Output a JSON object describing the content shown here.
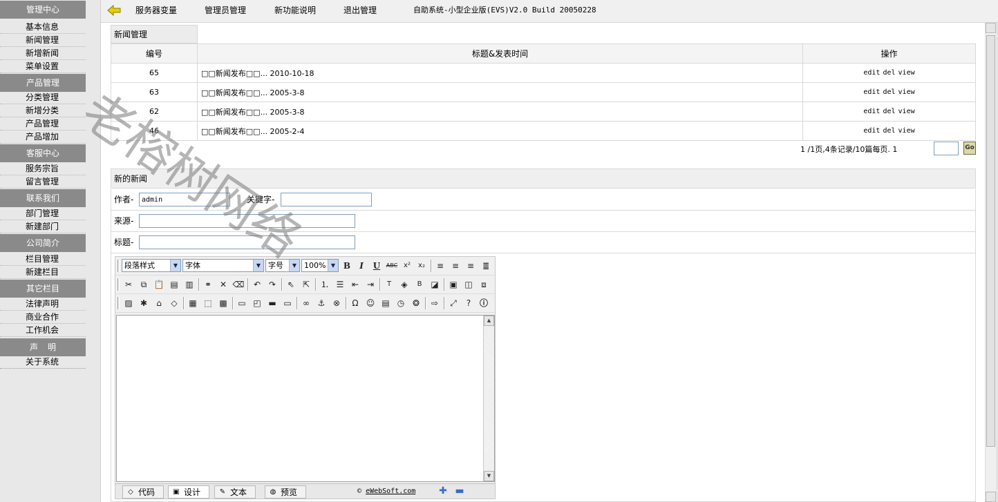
{
  "sidebar": {
    "sections": [
      {
        "title": "管理中心",
        "items": [
          "基本信息",
          "新闻管理",
          "新增新闻",
          "菜单设置"
        ]
      },
      {
        "title": "产品管理",
        "items": [
          "分类管理",
          "新增分类",
          "产品管理",
          "产品增加"
        ]
      },
      {
        "title": "客服中心",
        "items": [
          "服务宗旨",
          "留言管理"
        ]
      },
      {
        "title": "联系我们",
        "items": [
          "部门管理",
          "新建部门"
        ]
      },
      {
        "title": "公司简介",
        "items": [
          "栏目管理",
          "新建栏目"
        ]
      },
      {
        "title": "其它栏目",
        "items": [
          "法律声明",
          "商业合作",
          "工作机会"
        ]
      },
      {
        "title": "声明",
        "items": [
          "关于系统"
        ]
      }
    ]
  },
  "topbar": {
    "links": [
      "服务器变量",
      "管理员管理",
      "新功能说明",
      "退出管理"
    ],
    "system_info": "自助系统-小型企业版(EVS)V2.0 Build 20050228"
  },
  "news_list": {
    "tab_label": "新闻管理",
    "columns": [
      "编号",
      "标题&发表时间",
      "操作"
    ],
    "rows": [
      {
        "id": "65",
        "title": "□□新闻发布□□... 2010-10-18"
      },
      {
        "id": "63",
        "title": "□□新闻发布□□... 2005-3-8"
      },
      {
        "id": "62",
        "title": "□□新闻发布□□... 2005-3-8"
      },
      {
        "id": "46",
        "title": "□□新闻发布□□... 2005-2-4"
      }
    ],
    "ops": [
      "edit",
      "del",
      "view"
    ],
    "pager_text": "1 /1页,4条记录/10篇每页. 1",
    "go_label": "Go"
  },
  "new_news": {
    "heading": "新的新闻",
    "author_label": "作者-",
    "author_value": "admin",
    "keyword_label": "关键字-",
    "keyword_value": "",
    "source_label": "来源-",
    "source_value": "",
    "title_label": "标题-",
    "title_value": ""
  },
  "editor": {
    "paragraph_style": "段落样式",
    "font": "字体",
    "font_size": "字号",
    "zoom": "100%",
    "modes": [
      "代码",
      "设计",
      "文本",
      "预览"
    ],
    "active_mode": "设计",
    "copyright_prefix": "©",
    "copyright_site": "eWebSoft.com"
  },
  "watermark": "老榕树网络",
  "colors": {
    "sidebar_bg": "#e8e8e8",
    "section_head_bg": "#8a8a8a",
    "back_arrow": "#e6d000"
  }
}
